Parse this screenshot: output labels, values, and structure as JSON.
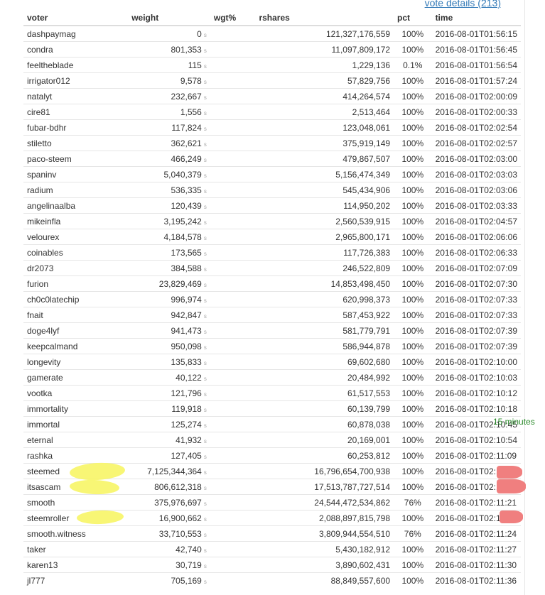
{
  "header": {
    "vote_details_label": "vote details (213)"
  },
  "table": {
    "columns": [
      "voter",
      "weight",
      "wgt%",
      "rshares",
      "pct",
      "time"
    ],
    "weight_unit": "s",
    "rows": [
      {
        "voter": "dashpaymag",
        "weight": "0",
        "rshares": "121,327,176,559",
        "pct": "100%",
        "time": "2016-08-01T01:56:15"
      },
      {
        "voter": "condra",
        "weight": "801,353",
        "rshares": "11,097,809,172",
        "pct": "100%",
        "time": "2016-08-01T01:56:45"
      },
      {
        "voter": "feeltheblade",
        "weight": "115",
        "rshares": "1,229,136",
        "pct": "0.1%",
        "time": "2016-08-01T01:56:54"
      },
      {
        "voter": "irrigator012",
        "weight": "9,578",
        "rshares": "57,829,756",
        "pct": "100%",
        "time": "2016-08-01T01:57:24"
      },
      {
        "voter": "natalyt",
        "weight": "232,667",
        "rshares": "414,264,574",
        "pct": "100%",
        "time": "2016-08-01T02:00:09"
      },
      {
        "voter": "cire81",
        "weight": "1,556",
        "rshares": "2,513,464",
        "pct": "100%",
        "time": "2016-08-01T02:00:33"
      },
      {
        "voter": "fubar-bdhr",
        "weight": "117,824",
        "rshares": "123,048,061",
        "pct": "100%",
        "time": "2016-08-01T02:02:54"
      },
      {
        "voter": "stiletto",
        "weight": "362,621",
        "rshares": "375,919,149",
        "pct": "100%",
        "time": "2016-08-01T02:02:57"
      },
      {
        "voter": "paco-steem",
        "weight": "466,249",
        "rshares": "479,867,507",
        "pct": "100%",
        "time": "2016-08-01T02:03:00"
      },
      {
        "voter": "spaninv",
        "weight": "5,040,379",
        "rshares": "5,156,474,349",
        "pct": "100%",
        "time": "2016-08-01T02:03:03"
      },
      {
        "voter": "radium",
        "weight": "536,335",
        "rshares": "545,434,906",
        "pct": "100%",
        "time": "2016-08-01T02:03:06"
      },
      {
        "voter": "angelinaalba",
        "weight": "120,439",
        "rshares": "114,950,202",
        "pct": "100%",
        "time": "2016-08-01T02:03:33"
      },
      {
        "voter": "mikeinfla",
        "weight": "3,195,242",
        "rshares": "2,560,539,915",
        "pct": "100%",
        "time": "2016-08-01T02:04:57"
      },
      {
        "voter": "velourex",
        "weight": "4,184,578",
        "rshares": "2,965,800,171",
        "pct": "100%",
        "time": "2016-08-01T02:06:06"
      },
      {
        "voter": "coinables",
        "weight": "173,565",
        "rshares": "117,726,383",
        "pct": "100%",
        "time": "2016-08-01T02:06:33"
      },
      {
        "voter": "dr2073",
        "weight": "384,588",
        "rshares": "246,522,809",
        "pct": "100%",
        "time": "2016-08-01T02:07:09"
      },
      {
        "voter": "furion",
        "weight": "23,829,469",
        "rshares": "14,853,498,450",
        "pct": "100%",
        "time": "2016-08-01T02:07:30"
      },
      {
        "voter": "ch0c0latechip",
        "weight": "996,974",
        "rshares": "620,998,373",
        "pct": "100%",
        "time": "2016-08-01T02:07:33"
      },
      {
        "voter": "fnait",
        "weight": "942,847",
        "rshares": "587,453,922",
        "pct": "100%",
        "time": "2016-08-01T02:07:33"
      },
      {
        "voter": "doge4lyf",
        "weight": "941,473",
        "rshares": "581,779,791",
        "pct": "100%",
        "time": "2016-08-01T02:07:39"
      },
      {
        "voter": "keepcalmand",
        "weight": "950,098",
        "rshares": "586,944,878",
        "pct": "100%",
        "time": "2016-08-01T02:07:39"
      },
      {
        "voter": "longevity",
        "weight": "135,833",
        "rshares": "69,602,680",
        "pct": "100%",
        "time": "2016-08-01T02:10:00"
      },
      {
        "voter": "gamerate",
        "weight": "40,122",
        "rshares": "20,484,992",
        "pct": "100%",
        "time": "2016-08-01T02:10:03"
      },
      {
        "voter": "vootka",
        "weight": "121,796",
        "rshares": "61,517,553",
        "pct": "100%",
        "time": "2016-08-01T02:10:12"
      },
      {
        "voter": "immortality",
        "weight": "119,918",
        "rshares": "60,139,799",
        "pct": "100%",
        "time": "2016-08-01T02:10:18"
      },
      {
        "voter": "immortal",
        "weight": "125,274",
        "rshares": "60,878,038",
        "pct": "100%",
        "time": "2016-08-01T02:10:45"
      },
      {
        "voter": "eternal",
        "weight": "41,932",
        "rshares": "20,169,001",
        "pct": "100%",
        "time": "2016-08-01T02:10:54"
      },
      {
        "voter": "rashka",
        "weight": "127,405",
        "rshares": "60,253,812",
        "pct": "100%",
        "time": "2016-08-01T02:11:09"
      },
      {
        "voter": "steemed",
        "weight": "7,125,344,364",
        "rshares": "16,796,654,700,938",
        "pct": "100%",
        "time": "2016-08-01T02:11:18"
      },
      {
        "voter": "itsascam",
        "weight": "806,612,318",
        "rshares": "17,513,787,727,514",
        "pct": "100%",
        "time": "2016-08-01T02:11:21"
      },
      {
        "voter": "smooth",
        "weight": "375,976,697",
        "rshares": "24,544,472,534,862",
        "pct": "76%",
        "time": "2016-08-01T02:11:21"
      },
      {
        "voter": "steemroller",
        "weight": "16,900,662",
        "rshares": "2,088,897,815,798",
        "pct": "100%",
        "time": "2016-08-01T02:11:24"
      },
      {
        "voter": "smooth.witness",
        "weight": "33,710,553",
        "rshares": "3,809,944,554,510",
        "pct": "76%",
        "time": "2016-08-01T02:11:24"
      },
      {
        "voter": "taker",
        "weight": "42,740",
        "rshares": "5,430,182,912",
        "pct": "100%",
        "time": "2016-08-01T02:11:27"
      },
      {
        "voter": "karen13",
        "weight": "30,719",
        "rshares": "3,890,602,431",
        "pct": "100%",
        "time": "2016-08-01T02:11:30"
      },
      {
        "voter": "jl777",
        "weight": "705,169",
        "rshares": "88,849,557,600",
        "pct": "100%",
        "time": "2016-08-01T02:11:36"
      }
    ]
  },
  "side_note": "15 minutes",
  "colors": {
    "highlight": "#f7f566",
    "redact": "#f07f7f",
    "note": "#2a8a2a",
    "link": "#337ab7"
  }
}
